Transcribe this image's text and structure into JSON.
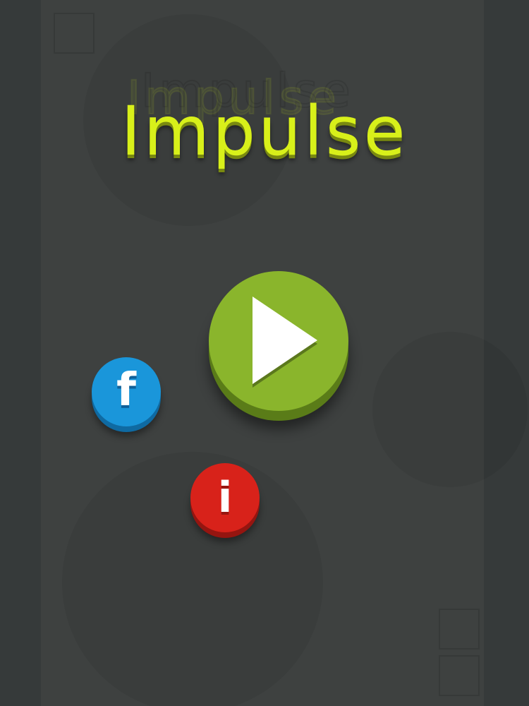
{
  "game": {
    "title": "Impulse"
  },
  "buttons": {
    "play_icon": "play-triangle-icon",
    "facebook_glyph": "f",
    "facebook_icon": "facebook-icon",
    "info_glyph": "i",
    "info_icon": "info-icon"
  },
  "colors": {
    "background": "#3e4140",
    "title": "#d8f01a",
    "play": "#8ab52c",
    "facebook": "#1a96da",
    "info": "#d8221a"
  }
}
